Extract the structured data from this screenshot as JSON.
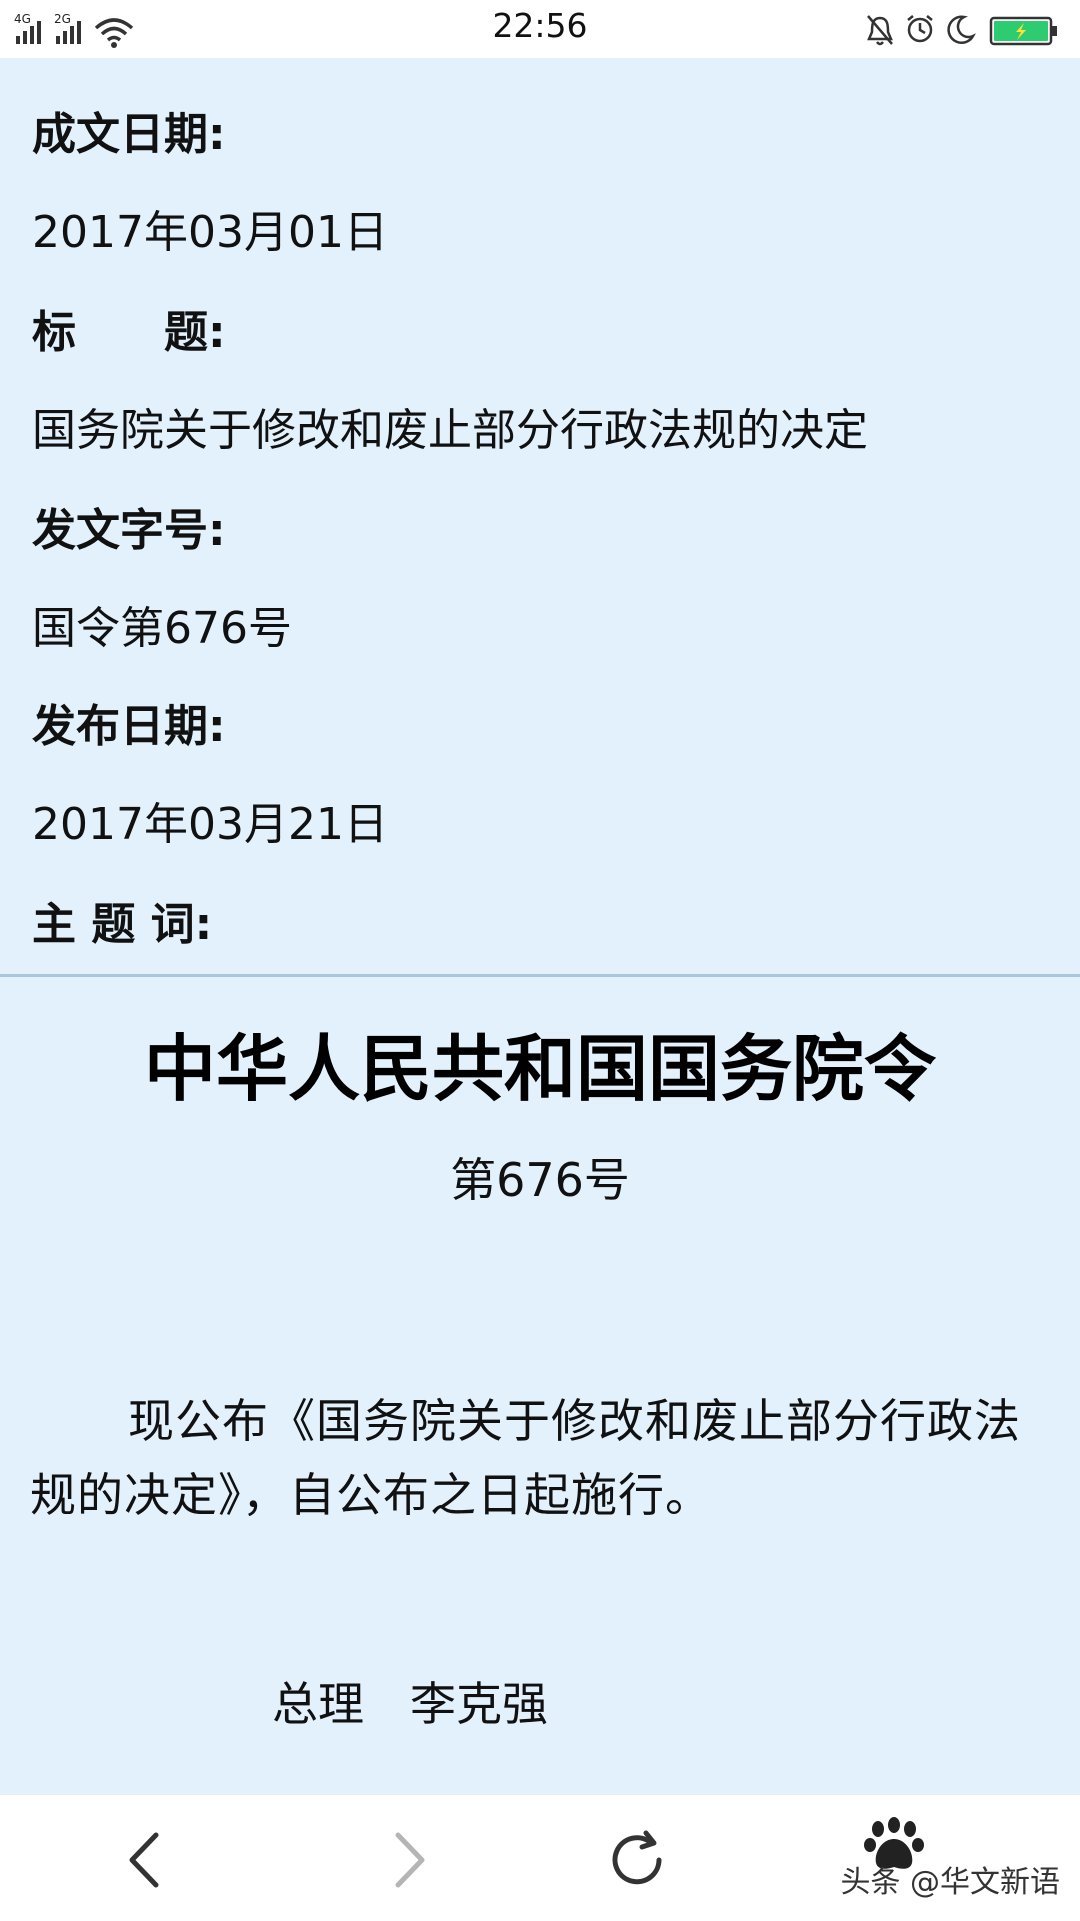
{
  "status_bar": {
    "time": "22:56",
    "network_1": "4G",
    "network_2": "2G",
    "icons": [
      "signal-icon",
      "wifi-icon",
      "mute-bell-icon",
      "alarm-icon",
      "moon-icon",
      "battery-charging-icon"
    ],
    "battery_color": "#2ecc71"
  },
  "meta": {
    "written_date_label": "成文日期:",
    "written_date_value": "2017年03月01日",
    "title_label": "标　　题:",
    "title_value": "国务院关于修改和废止部分行政法规的决定",
    "doc_no_label": "发文字号:",
    "doc_no_value": "国令第676号",
    "publish_date_label": "发布日期:",
    "publish_date_value": "2017年03月21日",
    "keywords_label": "主 题 词:"
  },
  "document": {
    "title": "中华人民共和国国务院令",
    "number": "第676号",
    "body": "现公布《国务院关于修改和废止部分行政法规的决定》，自公布之日起施行。",
    "signature": "总理　李克强"
  },
  "bottom_bar": {
    "icons": [
      "back-icon",
      "forward-icon",
      "refresh-icon",
      "paw-icon"
    ],
    "watermark": "头条 @华文新语"
  },
  "colors": {
    "content_background": "#e2f1fc",
    "divider": "#a9c6db"
  }
}
